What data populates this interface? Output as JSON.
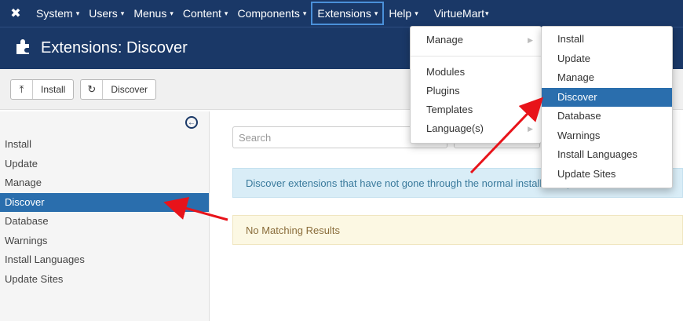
{
  "topnav": {
    "logo_icon": "joomla-logo-icon",
    "items": [
      {
        "label": "System",
        "caret": "▾"
      },
      {
        "label": "Users",
        "caret": "▾"
      },
      {
        "label": "Menus",
        "caret": "▾"
      },
      {
        "label": "Content",
        "caret": "▾"
      },
      {
        "label": "Components",
        "caret": "▾"
      },
      {
        "label": "Extensions",
        "caret": "▾"
      },
      {
        "label": "Help",
        "caret": "▾"
      },
      {
        "label": "VirtueMart",
        "caret": "▾"
      }
    ]
  },
  "titlebar": {
    "icon": "puzzle-icon",
    "title": "Extensions: Discover"
  },
  "toolbar": {
    "install_label": "Install",
    "discover_label": "Discover"
  },
  "sidebar": {
    "items": [
      {
        "label": "Install"
      },
      {
        "label": "Update"
      },
      {
        "label": "Manage"
      },
      {
        "label": "Discover"
      },
      {
        "label": "Database"
      },
      {
        "label": "Warnings"
      },
      {
        "label": "Install Languages"
      },
      {
        "label": "Update Sites"
      }
    ],
    "active": "Discover"
  },
  "main": {
    "search_placeholder": "Search",
    "info_text": "Discover extensions that have not gone through the normal installation process.",
    "warning_text": "No Matching Results"
  },
  "extensions_menu": {
    "items": [
      {
        "label": "Manage"
      },
      {
        "label": "Modules"
      },
      {
        "label": "Plugins"
      },
      {
        "label": "Templates"
      },
      {
        "label": "Language(s)"
      }
    ]
  },
  "manage_submenu": {
    "items": [
      {
        "label": "Install"
      },
      {
        "label": "Update"
      },
      {
        "label": "Manage"
      },
      {
        "label": "Discover"
      },
      {
        "label": "Database"
      },
      {
        "label": "Warnings"
      },
      {
        "label": "Install Languages"
      },
      {
        "label": "Update Sites"
      }
    ],
    "active": "Discover"
  },
  "colors": {
    "nav_bg": "#1a3867",
    "active_bg": "#2a6ead",
    "arrow": "#e8131a",
    "info_bg": "#d9edf7",
    "warning_bg": "#fcf8e3"
  }
}
